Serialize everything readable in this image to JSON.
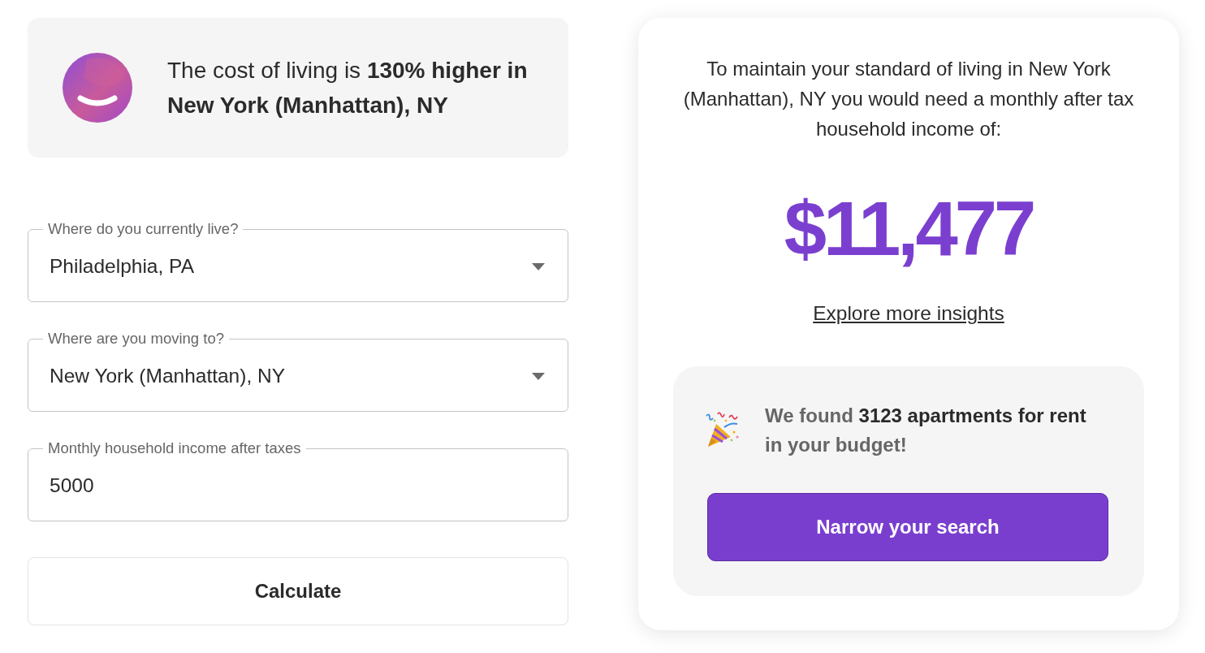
{
  "banner": {
    "text": "The cost of living is **130% higher in New York (Manhattan), NY**"
  },
  "form": {
    "fields": [
      {
        "kind": "select",
        "label": "Where do you currently live?",
        "value": "Philadelphia, PA"
      },
      {
        "kind": "select",
        "label": "Where are you moving to?",
        "value": "New York (Manhattan), NY"
      },
      {
        "kind": "text",
        "label": "Monthly household income after taxes",
        "value": "5000"
      }
    ],
    "submit": "Calculate"
  },
  "result": {
    "intro": "To maintain your standard of living in New York (Manhattan), NY you would need a monthly after tax household income of:",
    "amount": "$11,477",
    "link": "Explore more insights",
    "apartments": {
      "text": "We found **3123 apartments for rent** in your budget!",
      "button": "Narrow your search"
    }
  }
}
